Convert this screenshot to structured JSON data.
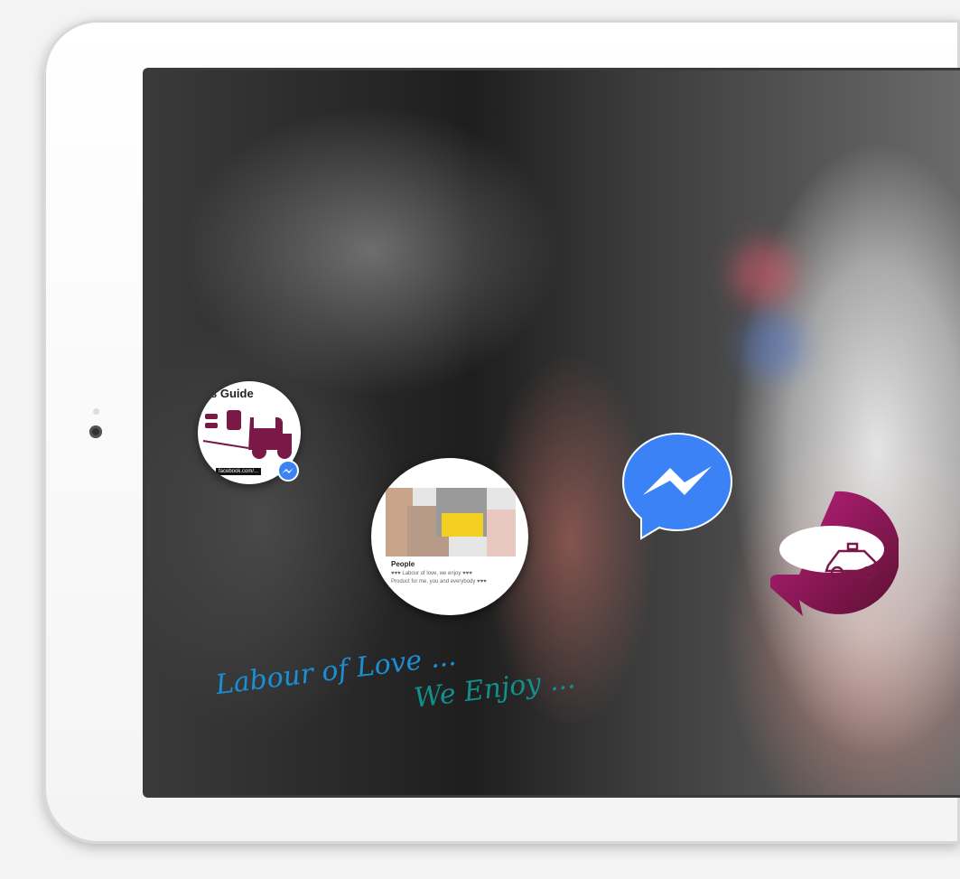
{
  "bus_guide": {
    "title": "s Guide",
    "footer": "facebook.com/...",
    "icon": "messenger-icon"
  },
  "people_card": {
    "title": "People",
    "line1": "♥♥♥ Labour of love, we enjoy ♥♥♥",
    "line2": "Product for me, you and everybody ♥♥♥"
  },
  "tagline": {
    "line1": "Labour of Love ...",
    "line2": "We Enjoy ..."
  },
  "colors": {
    "messenger": "#3b82f6",
    "taxi": "#8a1a5a",
    "tag1": "#1a8fd6",
    "tag2": "#12908e"
  }
}
